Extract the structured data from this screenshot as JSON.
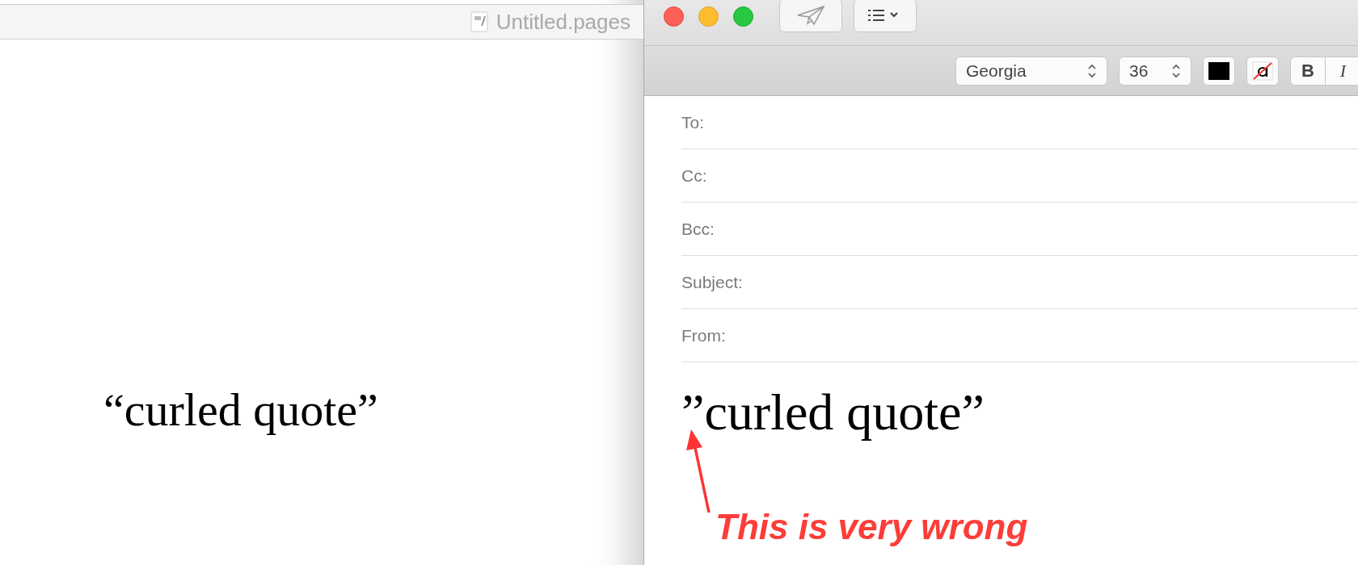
{
  "pages_window": {
    "title": "Untitled.pages",
    "body_text": "“curled quote”"
  },
  "mail_window": {
    "toolbar": {
      "font": "Georgia",
      "size": "36",
      "bold_label": "B",
      "italic_label": "I"
    },
    "fields": [
      {
        "label": "To:"
      },
      {
        "label": "Cc:"
      },
      {
        "label": "Bcc:"
      },
      {
        "label": "Subject:"
      },
      {
        "label": "From:"
      }
    ],
    "body_text": "”curled quote”"
  },
  "annotation": {
    "text": "This is very wrong"
  }
}
